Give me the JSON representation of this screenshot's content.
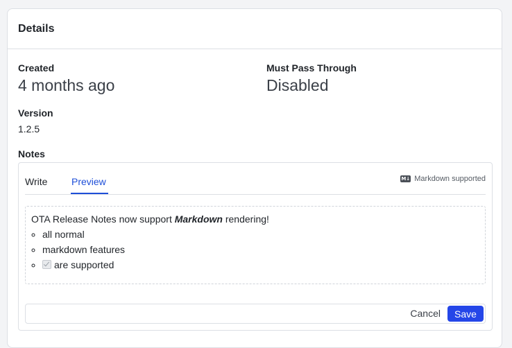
{
  "card": {
    "title": "Details"
  },
  "fields": {
    "created": {
      "label": "Created",
      "value": "4 months ago"
    },
    "must_pass": {
      "label": "Must Pass Through",
      "value": "Disabled"
    },
    "version": {
      "label": "Version",
      "value": "1.2.5"
    },
    "notes": {
      "label": "Notes"
    }
  },
  "editor": {
    "tabs": [
      {
        "label": "Write",
        "active": false
      },
      {
        "label": "Preview",
        "active": true
      }
    ],
    "markdown_icon": "M↓",
    "markdown_hint": "Markdown supported",
    "preview": {
      "intro_before": "OTA Release Notes now support ",
      "intro_emphasis": "Markdown",
      "intro_after": " rendering!",
      "items": [
        "all normal",
        "markdown features",
        "are supported"
      ],
      "checkbox_checked": true
    },
    "actions": {
      "cancel": "Cancel",
      "save": "Save"
    }
  },
  "colors": {
    "accent": "#1d4ed8",
    "save_button": "#2446e8"
  }
}
